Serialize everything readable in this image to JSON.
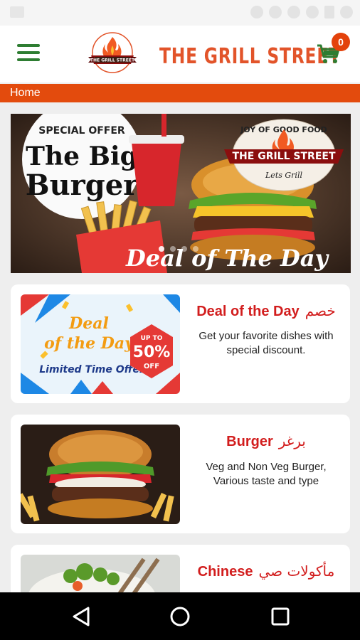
{
  "app": {
    "brand_title": "THE GRILL STREET",
    "cart_count": "0"
  },
  "breadcrumb": "Home",
  "banner": {
    "offer_text": "SPECIAL OFFER",
    "headline_line1": "The Big",
    "headline_line2": "Burger",
    "logo_tagline": "JOY OF GOOD FOOD",
    "logo_name": "THE GRILL STREET",
    "logo_sub": "Lets Grill",
    "caption": "Deal of The Day"
  },
  "cards": [
    {
      "title": "Deal of the Day",
      "title_ar": "خصم",
      "description": "Get your favorite dishes with special discount.",
      "image_text1": "Deal",
      "image_text2": "of the Day",
      "image_text3": "Limited Time Offer",
      "badge_line1": "UP TO",
      "badge_line2": "50%",
      "badge_line3": "OFF"
    },
    {
      "title": "Burger",
      "title_ar": "برغر",
      "description": "Veg and Non Veg Burger, Various taste and type"
    },
    {
      "title": "Chinese",
      "title_ar": "مأكولات صي",
      "description": ""
    }
  ],
  "colors": {
    "brand_orange": "#e34b0d",
    "title_red": "#d21d1d",
    "menu_green": "#2e7d32"
  }
}
